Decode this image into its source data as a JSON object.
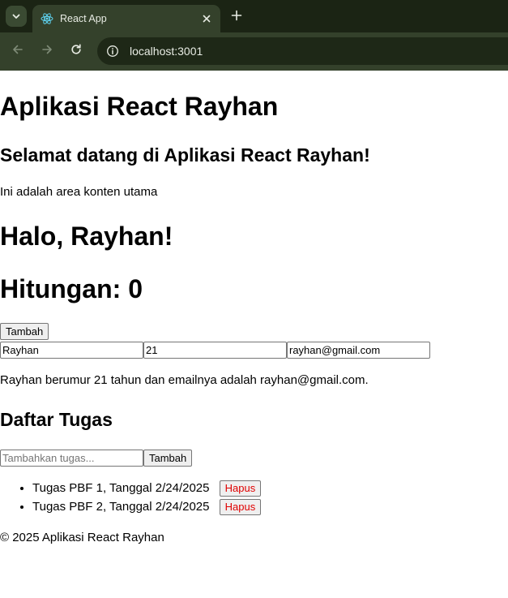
{
  "browser": {
    "tab": {
      "title": "React App"
    },
    "url": "localhost:3001"
  },
  "page": {
    "app_title": "Aplikasi React Rayhan",
    "welcome": "Selamat datang di Aplikasi React Rayhan!",
    "content_text": "Ini adalah area konten utama",
    "greeting": "Halo, Rayhan!",
    "counter_label": "Hitungan: ",
    "counter_value": "0",
    "add_button": "Tambah",
    "form": {
      "name": "Rayhan",
      "age": "21",
      "email": "rayhan@gmail.com"
    },
    "info_text": "Rayhan berumur 21 tahun dan emailnya adalah rayhan@gmail.com.",
    "tasks_title": "Daftar Tugas",
    "task_input_placeholder": "Tambahkan tugas...",
    "task_add_button": "Tambah",
    "tasks": [
      {
        "label": "Tugas PBF 1, Tanggal 2/24/2025",
        "delete": "Hapus"
      },
      {
        "label": "Tugas PBF 2, Tanggal 2/24/2025",
        "delete": "Hapus"
      }
    ],
    "footer": "© 2025 Aplikasi React Rayhan"
  },
  "icons": {
    "tab_menu": "chevron-down-icon",
    "favicon": "react-logo-icon",
    "close": "close-icon",
    "new_tab": "plus-icon",
    "back": "arrow-left-icon",
    "forward": "arrow-right-icon",
    "reload": "reload-icon",
    "site_info": "info-icon"
  },
  "colors": {
    "tabbar_bg": "#1b2414",
    "toolbar_bg": "#34412b",
    "delete_text": "#e00000"
  }
}
